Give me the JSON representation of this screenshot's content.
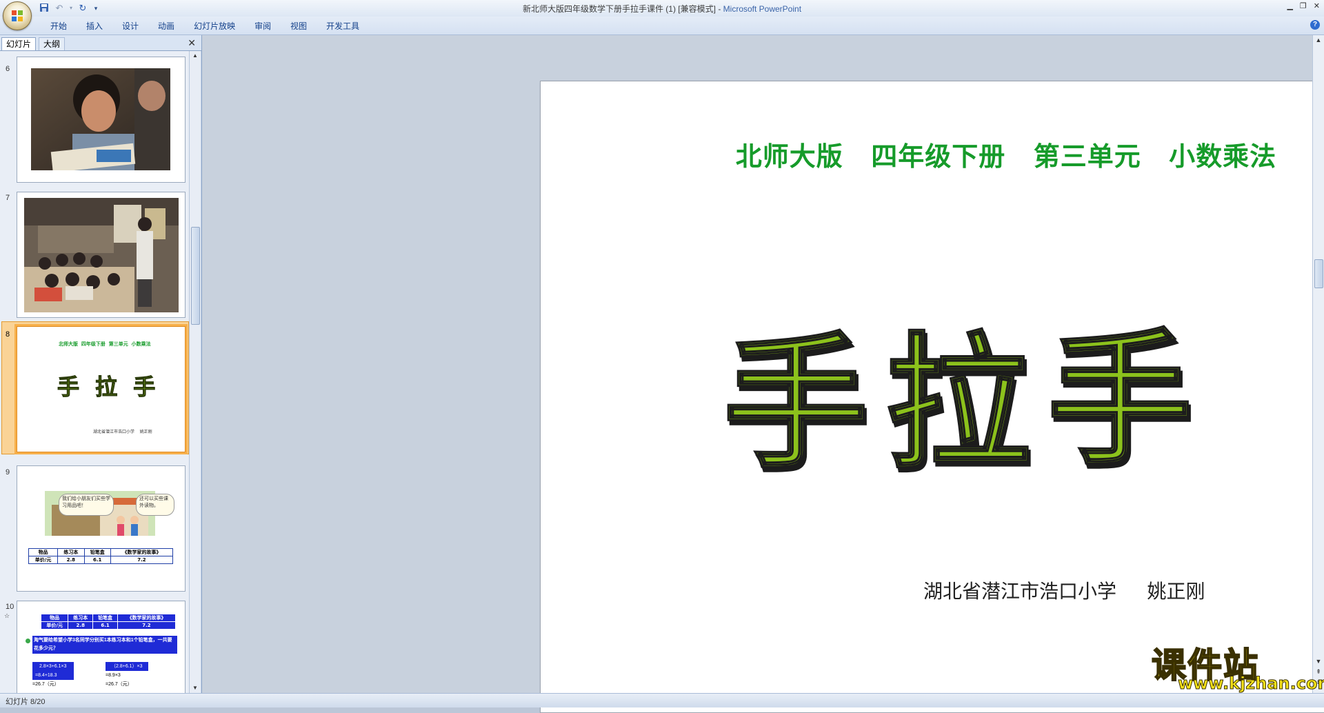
{
  "window": {
    "title": "新北师大版四年级数学下册手拉手课件 (1) [兼容模式]",
    "title_sep": " - ",
    "app_name": "Microsoft PowerPoint"
  },
  "ribbon": {
    "tabs": [
      "开始",
      "插入",
      "设计",
      "动画",
      "幻灯片放映",
      "审阅",
      "视图",
      "开发工具"
    ]
  },
  "left_pane": {
    "tab_slides": "幻灯片",
    "tab_outline": "大纲",
    "thumbnails": [
      {
        "number": "6"
      },
      {
        "number": "7"
      },
      {
        "number": "8",
        "selected": true,
        "mini_title": "北师大版  四年级下册  第三单元  小数乘法",
        "mini_big": "手 拉 手",
        "mini_sub": "湖北省潜江市浩口小学    姚正刚"
      },
      {
        "number": "9",
        "bubble1": "我们给小朋友们买些学习用品吧！",
        "bubble2": "还可以买些课外读物。",
        "table_headers": [
          "物品",
          "练习本",
          "铅笔盒",
          "《数学家的故事》"
        ],
        "table_row": [
          "单价/元",
          "2.8",
          "6.1",
          "7.2"
        ]
      },
      {
        "number": "10",
        "table_headers": [
          "物品",
          "练习本",
          "铅笔盒",
          "《数学家的故事》"
        ],
        "table_row": [
          "单价/元",
          "2.8",
          "6.1",
          "7.2"
        ],
        "question": "淘气要给希望小学3名同学分别买1本练习本和1个铅笔盒，一共要花多少元？",
        "calc_left": [
          "2.8×3+6.1×3",
          "=8.4+18.3",
          "=26.7（元）"
        ],
        "calc_right": [
          "（2.8+6.1）×3",
          "=8.9×3",
          "=26.7（元）"
        ]
      }
    ]
  },
  "slide": {
    "title": "北师大版  四年级下册  第三单元  小数乘法",
    "big_title": [
      "手",
      "拉",
      "手"
    ],
    "subtitle": "湖北省潜江市浩口小学     姚正刚",
    "title_color": "#169b2a",
    "big_title_color": "#8cc21a"
  },
  "status_bar": {
    "text": "幻灯片 8/20"
  },
  "watermark": {
    "text": "课件站",
    "url": "www.kjzhan.com"
  }
}
